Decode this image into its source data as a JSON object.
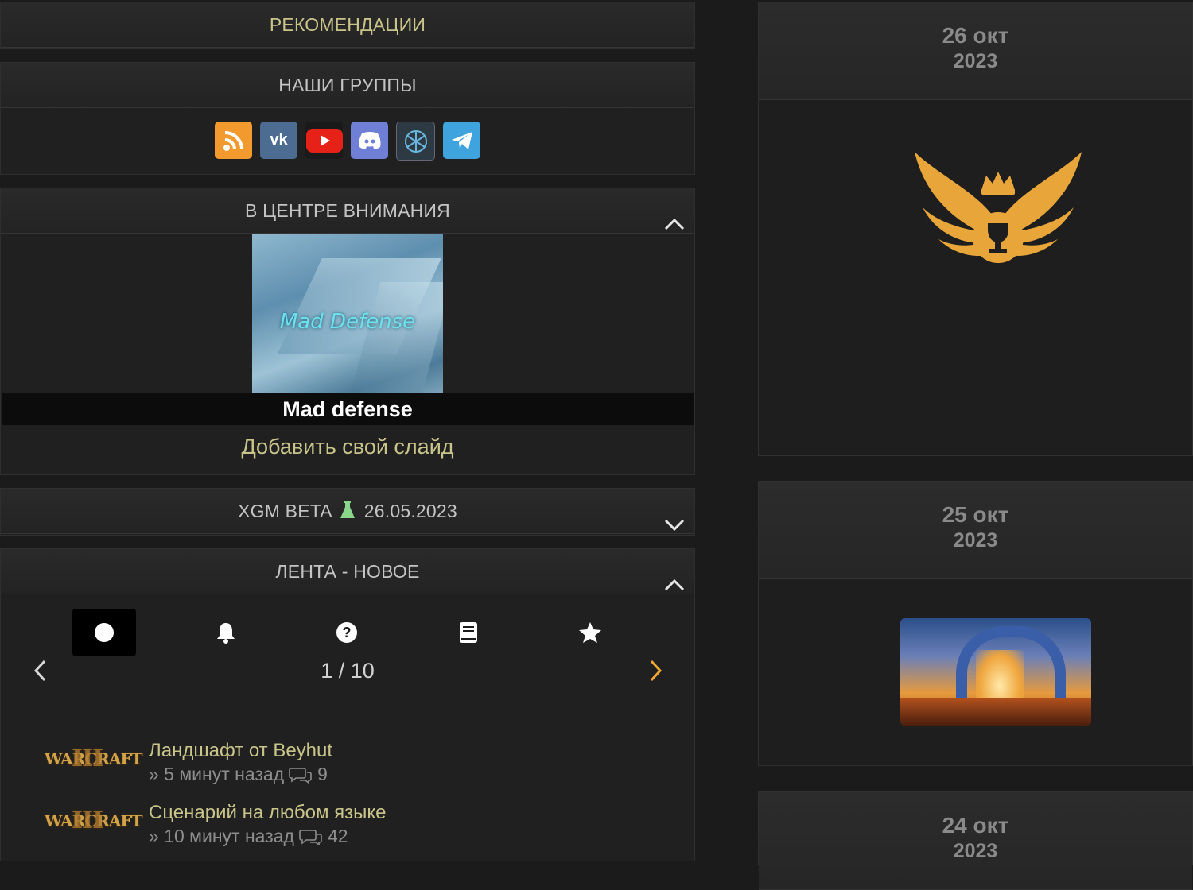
{
  "recommendations": {
    "title": "РЕКОМЕНДАЦИИ"
  },
  "groups": {
    "title": "НАШИ ГРУППЫ",
    "icons": [
      "rss-icon",
      "vk-icon",
      "youtube-icon",
      "discord-icon",
      "xgm-icon",
      "telegram-icon"
    ]
  },
  "spotlight": {
    "title": "В ЦЕНТРЕ ВНИМАНИЯ",
    "image_text": "Mad Defense",
    "caption": "Mad defense",
    "add_slide": "Добавить свой слайд"
  },
  "beta": {
    "title": "XGM BETA",
    "date": "26.05.2023"
  },
  "feed": {
    "title": "ЛЕНТА - НОВОЕ",
    "tab_icons": [
      "circle-icon",
      "bell-icon",
      "question-icon",
      "book-icon",
      "star-icon"
    ],
    "pager": "1 / 10",
    "items": [
      {
        "logo": "WARCRAFT",
        "title": "Ландшафт от Beyhut",
        "meta": "» 5 минут назад",
        "comments": "9"
      },
      {
        "logo": "WARCRAFT",
        "title": "Сценарий на любом языке",
        "meta": "» 10 минут назад",
        "comments": "42"
      }
    ]
  },
  "cards": [
    {
      "day": "26 окт",
      "year": "2023"
    },
    {
      "day": "25 окт",
      "year": "2023"
    },
    {
      "day": "24 окт",
      "year": "2023"
    }
  ],
  "colors": {
    "gold": "#c9c48a",
    "accent_orange": "#f0a833",
    "trophy": "#e8a63a"
  }
}
